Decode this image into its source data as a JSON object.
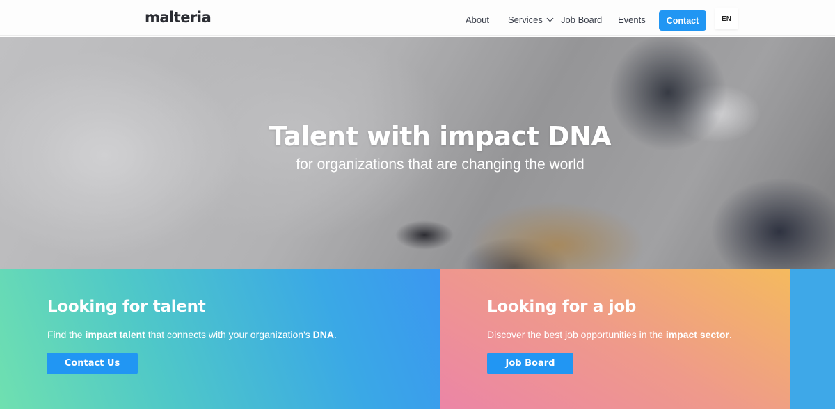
{
  "header": {
    "logo": "malteria",
    "nav": {
      "about": "About",
      "services": "Services",
      "job_board": "Job Board",
      "events": "Events",
      "contact": "Contact",
      "language": "EN"
    }
  },
  "hero": {
    "title": "Talent with impact DNA",
    "subtitle": "for organizations that are changing the world"
  },
  "talent_panel": {
    "heading": "Looking for talent",
    "text_1": "Find the ",
    "text_bold_1": "impact talent",
    "text_2": " that connects with your organization's ",
    "text_bold_2": "DNA",
    "text_3": ".",
    "button": "Contact Us"
  },
  "job_panel": {
    "heading": "Looking for a job",
    "text_1": "Discover the best job opportunities in the ",
    "text_bold_1": "impact sector",
    "text_2": ".",
    "button": "Job Board"
  },
  "colors": {
    "accent": "#2196f3",
    "talent_gradient_start": "#6fe0b0",
    "talent_gradient_end": "#3b97f0",
    "job_gradient_start": "#ec85a6",
    "job_gradient_end": "#f4ba5e"
  },
  "icons": {
    "services_dropdown": "chevron-down-icon"
  }
}
